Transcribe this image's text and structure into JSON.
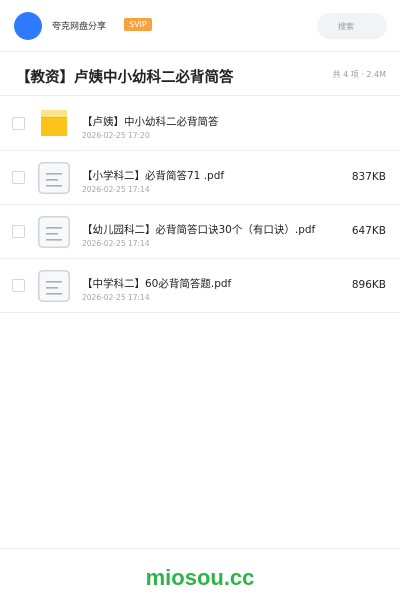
{
  "header": {
    "brand": "夸克网盘分享",
    "badge": "SVIP",
    "search_placeholder": "搜索"
  },
  "folder": {
    "title": "【教资】卢姨中小幼科二必背简答",
    "summary": "共 4 项 · 2.4M"
  },
  "files": [
    {
      "type": "folder",
      "icon": "folder-icon",
      "name": "【卢姨】中小幼科二必背简答",
      "date": "2026-02-25 17:20",
      "size": ""
    },
    {
      "type": "file",
      "icon": "document-icon",
      "name": "【小学科二】必背简答71 .pdf",
      "date": "2026-02-25 17:14",
      "size": "837KB"
    },
    {
      "type": "file",
      "icon": "document-icon",
      "name": "【幼儿园科二】必背简答口诀30个（有口诀）.pdf",
      "date": "2026-02-25 17:14",
      "size": "647KB"
    },
    {
      "type": "file",
      "icon": "document-icon",
      "name": "【中学科二】60必背简答题.pdf",
      "date": "2026-02-25 17:14",
      "size": "896KB"
    }
  ],
  "footer": {
    "watermark": "miosou.cc"
  },
  "colors": {
    "accent": "#2f7bff",
    "badge": "#f7a23b",
    "folder": "#fcc419",
    "watermark": "#2fb34a"
  }
}
